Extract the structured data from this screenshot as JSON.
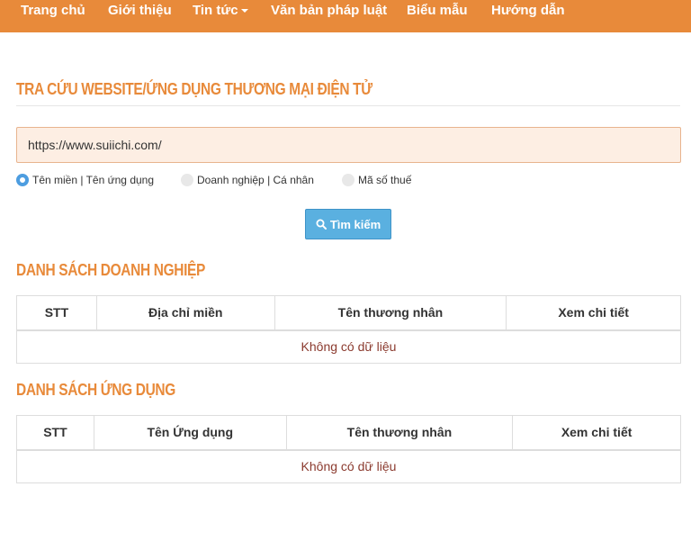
{
  "nav": {
    "items": [
      {
        "label": "Trang chủ"
      },
      {
        "label": "Giới thiệu"
      },
      {
        "label": "Tin tức"
      },
      {
        "label": "Văn bản pháp luật"
      },
      {
        "label": "Biểu mẫu"
      },
      {
        "label": "Hướng dẫn"
      }
    ]
  },
  "search": {
    "title": "TRA CỨU WEBSITE/ỨNG DỤNG THƯƠNG MẠI ĐIỆN TỬ",
    "value": "https://www.suiichi.com/",
    "options": [
      {
        "label": "Tên miền | Tên ứng dụng",
        "checked": true
      },
      {
        "label": "Doanh nghiệp | Cá nhân",
        "checked": false
      },
      {
        "label": "Mã số thuế",
        "checked": false
      }
    ],
    "button_label": "Tìm kiếm"
  },
  "business_list": {
    "title": "DANH SÁCH DOANH NGHIỆP",
    "columns": [
      "STT",
      "Địa chỉ miền",
      "Tên thương nhân",
      "Xem chi tiết"
    ],
    "empty_text": "Không có dữ liệu"
  },
  "app_list": {
    "title": "DANH SÁCH ỨNG DỤNG",
    "columns": [
      "STT",
      "Tên Ứng dụng",
      "Tên thương nhân",
      "Xem chi tiết"
    ],
    "empty_text": "Không có dữ liệu"
  },
  "colors": {
    "accent": "#e88a3a",
    "button": "#5ab0e0",
    "empty_text": "#8b3a2e"
  }
}
